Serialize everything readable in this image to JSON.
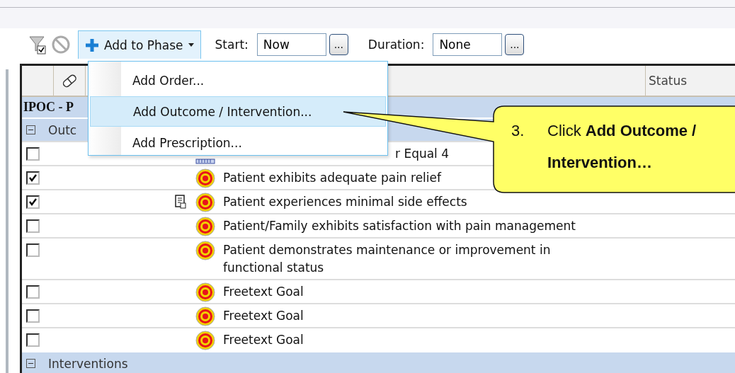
{
  "toolbar": {
    "add_button": "Add to Phase",
    "start": {
      "label": "Start:",
      "value": "Now",
      "button": "..."
    },
    "duration": {
      "label": "Duration:",
      "value": "None",
      "button": "..."
    }
  },
  "menu": [
    {
      "label": "Add Order...",
      "selected": false
    },
    {
      "label": "Add Outcome / Intervention...",
      "selected": true
    },
    {
      "label": "Add Prescription...",
      "selected": false
    }
  ],
  "grid": {
    "status_header": "Status",
    "section": "IPOC - P",
    "group": {
      "label": "Outc",
      "expanded": true
    },
    "rows": [
      {
        "checked": false,
        "kind": "ruler",
        "note": false,
        "text": "r Equal 4"
      },
      {
        "checked": true,
        "kind": "target",
        "note": false,
        "text": "Patient exhibits adequate pain relief"
      },
      {
        "checked": true,
        "kind": "target",
        "note": true,
        "text": "Patient experiences minimal side effects"
      },
      {
        "checked": false,
        "kind": "target",
        "note": false,
        "text": "Patient/Family exhibits satisfaction with pain management"
      },
      {
        "checked": false,
        "kind": "target",
        "note": false,
        "text": "Patient demonstrates maintenance or improvement in functional status"
      },
      {
        "checked": false,
        "kind": "target",
        "note": false,
        "text": "Freetext Goal"
      },
      {
        "checked": false,
        "kind": "target",
        "note": false,
        "text": "Freetext Goal"
      },
      {
        "checked": false,
        "kind": "target",
        "note": false,
        "text": "Freetext Goal"
      }
    ],
    "next_group": {
      "label": "Interventions",
      "expanded": true
    }
  },
  "callout": {
    "number": "3.",
    "text": "Click **Add Outcome /** **Intervention…**"
  }
}
